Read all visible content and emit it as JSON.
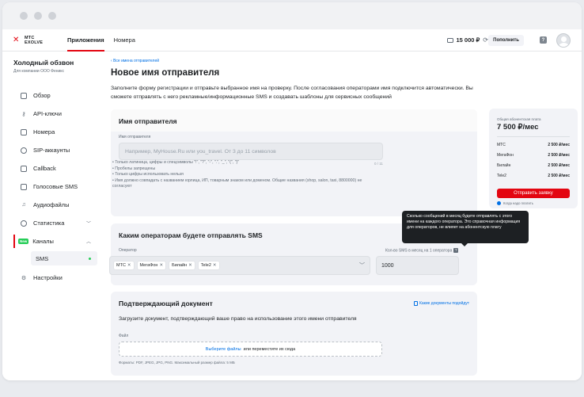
{
  "header": {
    "logo_line1": "МТС",
    "logo_line2": "EXOLVE",
    "nav": [
      {
        "label": "Приложения"
      },
      {
        "label": "Номера"
      }
    ],
    "balance": "15 000 ₽",
    "topup_label": "Пополнить"
  },
  "sidebar": {
    "title": "Холодный обзвон",
    "subtitle": "Для компании ООО Феникс",
    "items": [
      {
        "label": "Обзор"
      },
      {
        "label": "API-ключи"
      },
      {
        "label": "Номера"
      },
      {
        "label": "SIP-аккаунты"
      },
      {
        "label": "Callback"
      },
      {
        "label": "Голосовые SMS"
      },
      {
        "label": "Аудиофайлы"
      },
      {
        "label": "Статистика"
      },
      {
        "label": "Каналы",
        "badge": "New"
      },
      {
        "label": "SMS"
      },
      {
        "label": "Настройки"
      }
    ]
  },
  "main": {
    "back_link": "Все имена отправителей",
    "title": "Новое имя отправителя",
    "intro": "Заполните форму регистрации и отправьте выбранное имя на проверку. После согласования операторами имя подключится автоматически. Вы сможете отправлять с него рекламные/информационные SMS и создавать шаблоны для сервисных сообщений",
    "sender": {
      "heading": "Имя отправителя",
      "field_label": "Имя отправителя",
      "placeholder": "Например, MyHouse.Ru или you_travel. От 3 до 11 символов",
      "counter": "0 / 11",
      "rules": [
        "Только латиница, цифры и спецсимволы \"!\", \"?\", \"-\", \".\", \"_\", \"(\", \")\"",
        "Пробелы запрещены",
        "Только цифры использовать нельзя",
        "Имя должно совпадать с названием юрлица, ИП, товарным знаком или доменом. Общие названия (shop, salon, taxi, 8800000) не согласуют"
      ]
    },
    "operators": {
      "heading": "Каким операторам будете отправлять SMS",
      "operator_label": "Оператор",
      "tags": [
        "МТС",
        "МегаФон",
        "Билайн",
        "Tele2"
      ],
      "qty_label": "Кол-во SMS в месяц на 1 оператора",
      "qty_value": "1000",
      "tooltip": "Сколько сообщений в месяц будете отправлять с этого имени на каждого оператора. Это справочная информация для операторов, не влияет на абонентскую плату"
    },
    "document": {
      "heading": "Подтверждающий документ",
      "link": "Какие документы подойдут",
      "description": "Загрузите документ, подтверждающий ваше право на использование этого имени отправителя",
      "file_label": "Файл",
      "choose_link": "Выберите файлы",
      "drop_text": "или переместите их сюда",
      "formats": "Форматы: PDF, JPEG, JPG, PNG. Максимальный размер файла: 5 МБ"
    }
  },
  "price": {
    "label": "Общая абонентская плата",
    "total": "7 500 ₽/мес",
    "rows": [
      {
        "op": "МТС",
        "v": "2 500 ₽/мес"
      },
      {
        "op": "МегаФон",
        "v": "2 500 ₽/мес"
      },
      {
        "op": "Билайн",
        "v": "2 500 ₽/мес"
      },
      {
        "op": "Tele2",
        "v": "2 500 ₽/мес"
      }
    ],
    "button": "Отправить заявку",
    "note": "Когда надо платить"
  },
  "colors": {
    "accent": "#e30611",
    "link": "#0070e5",
    "new_badge": "#26cd58"
  }
}
